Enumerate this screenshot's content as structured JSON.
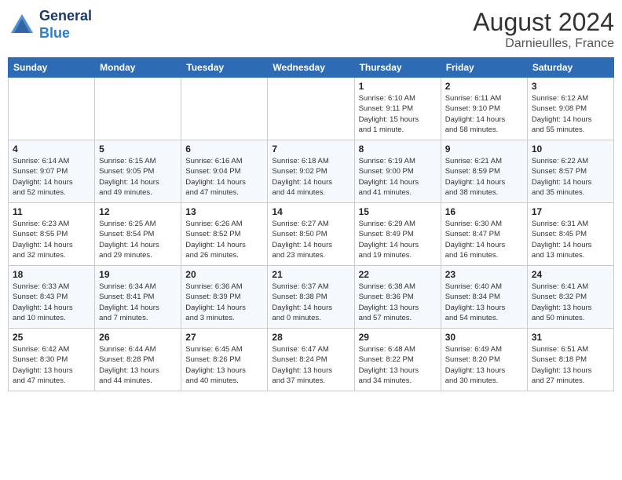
{
  "logo": {
    "line1": "General",
    "line2": "Blue"
  },
  "title": {
    "month_year": "August 2024",
    "location": "Darnieulles, France"
  },
  "days_of_week": [
    "Sunday",
    "Monday",
    "Tuesday",
    "Wednesday",
    "Thursday",
    "Friday",
    "Saturday"
  ],
  "weeks": [
    [
      {
        "day": "",
        "info": ""
      },
      {
        "day": "",
        "info": ""
      },
      {
        "day": "",
        "info": ""
      },
      {
        "day": "",
        "info": ""
      },
      {
        "day": "1",
        "info": "Sunrise: 6:10 AM\nSunset: 9:11 PM\nDaylight: 15 hours\nand 1 minute."
      },
      {
        "day": "2",
        "info": "Sunrise: 6:11 AM\nSunset: 9:10 PM\nDaylight: 14 hours\nand 58 minutes."
      },
      {
        "day": "3",
        "info": "Sunrise: 6:12 AM\nSunset: 9:08 PM\nDaylight: 14 hours\nand 55 minutes."
      }
    ],
    [
      {
        "day": "4",
        "info": "Sunrise: 6:14 AM\nSunset: 9:07 PM\nDaylight: 14 hours\nand 52 minutes."
      },
      {
        "day": "5",
        "info": "Sunrise: 6:15 AM\nSunset: 9:05 PM\nDaylight: 14 hours\nand 49 minutes."
      },
      {
        "day": "6",
        "info": "Sunrise: 6:16 AM\nSunset: 9:04 PM\nDaylight: 14 hours\nand 47 minutes."
      },
      {
        "day": "7",
        "info": "Sunrise: 6:18 AM\nSunset: 9:02 PM\nDaylight: 14 hours\nand 44 minutes."
      },
      {
        "day": "8",
        "info": "Sunrise: 6:19 AM\nSunset: 9:00 PM\nDaylight: 14 hours\nand 41 minutes."
      },
      {
        "day": "9",
        "info": "Sunrise: 6:21 AM\nSunset: 8:59 PM\nDaylight: 14 hours\nand 38 minutes."
      },
      {
        "day": "10",
        "info": "Sunrise: 6:22 AM\nSunset: 8:57 PM\nDaylight: 14 hours\nand 35 minutes."
      }
    ],
    [
      {
        "day": "11",
        "info": "Sunrise: 6:23 AM\nSunset: 8:55 PM\nDaylight: 14 hours\nand 32 minutes."
      },
      {
        "day": "12",
        "info": "Sunrise: 6:25 AM\nSunset: 8:54 PM\nDaylight: 14 hours\nand 29 minutes."
      },
      {
        "day": "13",
        "info": "Sunrise: 6:26 AM\nSunset: 8:52 PM\nDaylight: 14 hours\nand 26 minutes."
      },
      {
        "day": "14",
        "info": "Sunrise: 6:27 AM\nSunset: 8:50 PM\nDaylight: 14 hours\nand 23 minutes."
      },
      {
        "day": "15",
        "info": "Sunrise: 6:29 AM\nSunset: 8:49 PM\nDaylight: 14 hours\nand 19 minutes."
      },
      {
        "day": "16",
        "info": "Sunrise: 6:30 AM\nSunset: 8:47 PM\nDaylight: 14 hours\nand 16 minutes."
      },
      {
        "day": "17",
        "info": "Sunrise: 6:31 AM\nSunset: 8:45 PM\nDaylight: 14 hours\nand 13 minutes."
      }
    ],
    [
      {
        "day": "18",
        "info": "Sunrise: 6:33 AM\nSunset: 8:43 PM\nDaylight: 14 hours\nand 10 minutes."
      },
      {
        "day": "19",
        "info": "Sunrise: 6:34 AM\nSunset: 8:41 PM\nDaylight: 14 hours\nand 7 minutes."
      },
      {
        "day": "20",
        "info": "Sunrise: 6:36 AM\nSunset: 8:39 PM\nDaylight: 14 hours\nand 3 minutes."
      },
      {
        "day": "21",
        "info": "Sunrise: 6:37 AM\nSunset: 8:38 PM\nDaylight: 14 hours\nand 0 minutes."
      },
      {
        "day": "22",
        "info": "Sunrise: 6:38 AM\nSunset: 8:36 PM\nDaylight: 13 hours\nand 57 minutes."
      },
      {
        "day": "23",
        "info": "Sunrise: 6:40 AM\nSunset: 8:34 PM\nDaylight: 13 hours\nand 54 minutes."
      },
      {
        "day": "24",
        "info": "Sunrise: 6:41 AM\nSunset: 8:32 PM\nDaylight: 13 hours\nand 50 minutes."
      }
    ],
    [
      {
        "day": "25",
        "info": "Sunrise: 6:42 AM\nSunset: 8:30 PM\nDaylight: 13 hours\nand 47 minutes."
      },
      {
        "day": "26",
        "info": "Sunrise: 6:44 AM\nSunset: 8:28 PM\nDaylight: 13 hours\nand 44 minutes."
      },
      {
        "day": "27",
        "info": "Sunrise: 6:45 AM\nSunset: 8:26 PM\nDaylight: 13 hours\nand 40 minutes."
      },
      {
        "day": "28",
        "info": "Sunrise: 6:47 AM\nSunset: 8:24 PM\nDaylight: 13 hours\nand 37 minutes."
      },
      {
        "day": "29",
        "info": "Sunrise: 6:48 AM\nSunset: 8:22 PM\nDaylight: 13 hours\nand 34 minutes."
      },
      {
        "day": "30",
        "info": "Sunrise: 6:49 AM\nSunset: 8:20 PM\nDaylight: 13 hours\nand 30 minutes."
      },
      {
        "day": "31",
        "info": "Sunrise: 6:51 AM\nSunset: 8:18 PM\nDaylight: 13 hours\nand 27 minutes."
      }
    ]
  ]
}
